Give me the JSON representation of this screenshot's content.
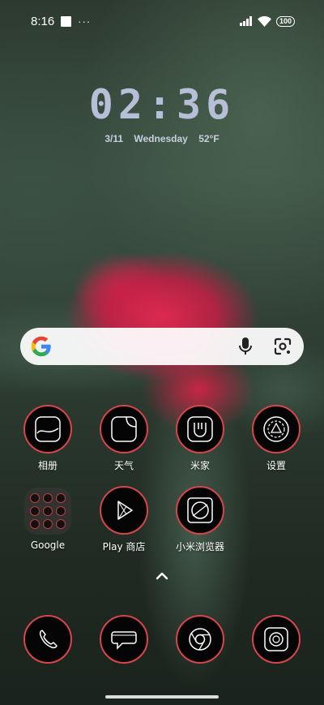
{
  "status_bar": {
    "time": "8:16",
    "dots": "···",
    "battery": "100"
  },
  "clock": {
    "time": "02:36",
    "date": "3/11",
    "weekday": "Wednesday",
    "temperature": "52°F"
  },
  "search": {
    "logo": "google-g-icon",
    "mic": "microphone-icon",
    "lens": "google-lens-icon"
  },
  "apps_row1": [
    {
      "label": "相册",
      "icon": "gallery-icon"
    },
    {
      "label": "天气",
      "icon": "weather-icon"
    },
    {
      "label": "米家",
      "icon": "mijia-icon"
    },
    {
      "label": "设置",
      "icon": "settings-icon"
    }
  ],
  "apps_row2": [
    {
      "label": "Google",
      "icon": "google-folder-icon"
    },
    {
      "label": "Play 商店",
      "icon": "play-store-icon"
    },
    {
      "label": "小米浏览器",
      "icon": "mi-browser-icon"
    }
  ],
  "dock": [
    {
      "icon": "phone-icon"
    },
    {
      "icon": "messages-icon"
    },
    {
      "icon": "chrome-icon"
    },
    {
      "icon": "camera-icon"
    }
  ],
  "colors": {
    "icon_ring": "#d8454a",
    "clock": "#b7bfd8"
  }
}
